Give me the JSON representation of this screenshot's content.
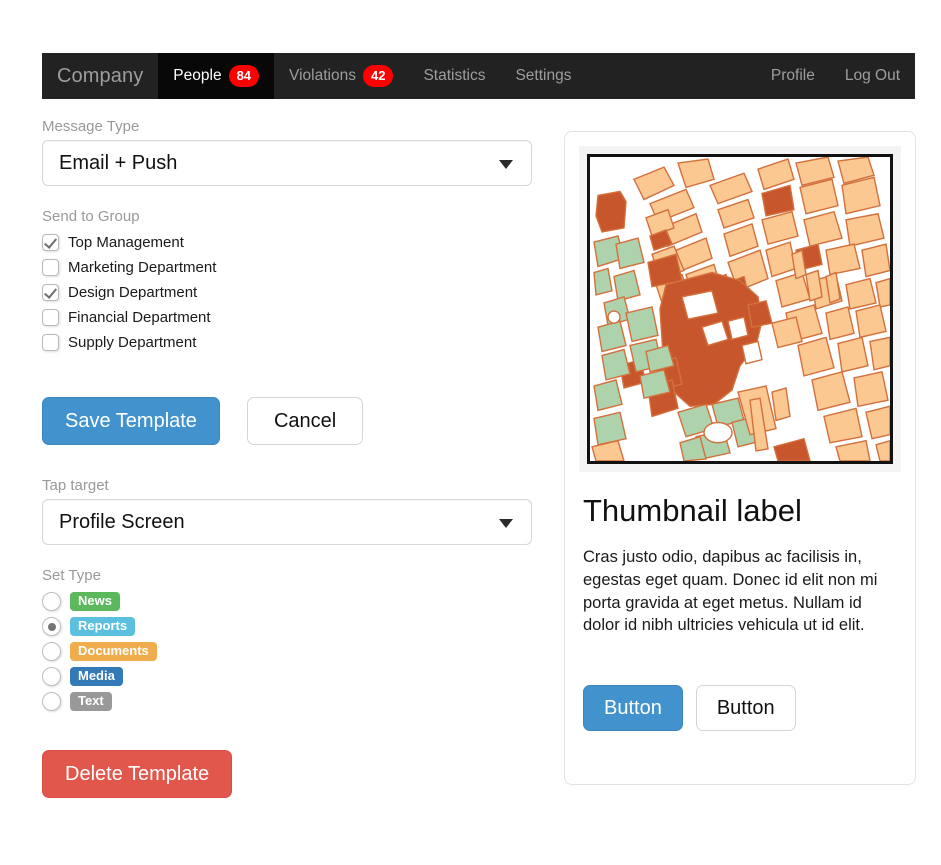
{
  "navbar": {
    "brand": "Company",
    "items": [
      {
        "label": "People",
        "badge": "84",
        "active": true
      },
      {
        "label": "Violations",
        "badge": "42",
        "active": false
      },
      {
        "label": "Statistics",
        "badge": "",
        "active": false
      },
      {
        "label": "Settings",
        "badge": "",
        "active": false
      }
    ],
    "right_items": [
      {
        "label": "Profile"
      },
      {
        "label": "Log Out"
      }
    ],
    "bg_color": "#222222",
    "active_bg_color": "#080808",
    "badge_color": "#ff0000",
    "text_color": "#9d9d9d"
  },
  "form": {
    "message_type": {
      "label": "Message Type",
      "value": "Email + Push"
    },
    "send_to_group": {
      "label": "Send to Group",
      "options": [
        {
          "label": "Top Management",
          "checked": true
        },
        {
          "label": "Marketing Department",
          "checked": false
        },
        {
          "label": "Design Department",
          "checked": true
        },
        {
          "label": "Financial Department",
          "checked": false
        },
        {
          "label": "Supply Department",
          "checked": false
        }
      ]
    },
    "save_button": "Save Template",
    "cancel_button": "Cancel",
    "tap_target": {
      "label": "Tap target",
      "value": "Profile Screen"
    },
    "set_type": {
      "label": "Set Type",
      "options": [
        {
          "label": "News",
          "selected": false,
          "color": "#5cb85c"
        },
        {
          "label": "Reports",
          "selected": true,
          "color": "#5bc0de"
        },
        {
          "label": "Documents",
          "selected": false,
          "color": "#f0ad4e"
        },
        {
          "label": "Media",
          "selected": false,
          "color": "#337ab7"
        },
        {
          "label": "Text",
          "selected": false,
          "color": "#999999"
        }
      ]
    },
    "delete_button": "Delete Template"
  },
  "thumbnail_card": {
    "image_alt": "city-street-map",
    "title": "Thumbnail label",
    "body": "Cras justo odio, dapibus ac facilisis in, egestas eget quam. Donec id elit non mi porta gravida at eget metus. Nullam id dolor id nibh ultricies vehicula ut id elit.",
    "primary_button": "Button",
    "secondary_button": "Button",
    "map_colors": {
      "building": "#fbc892",
      "highlight": "#c8562c",
      "park": "#aed2ab",
      "outline": "#d3703c",
      "background": "#ffffff"
    }
  },
  "theme": {
    "primary": "#4292cd",
    "danger": "#e2574c",
    "page_background": "#ffffff",
    "muted_label": "#999999"
  }
}
